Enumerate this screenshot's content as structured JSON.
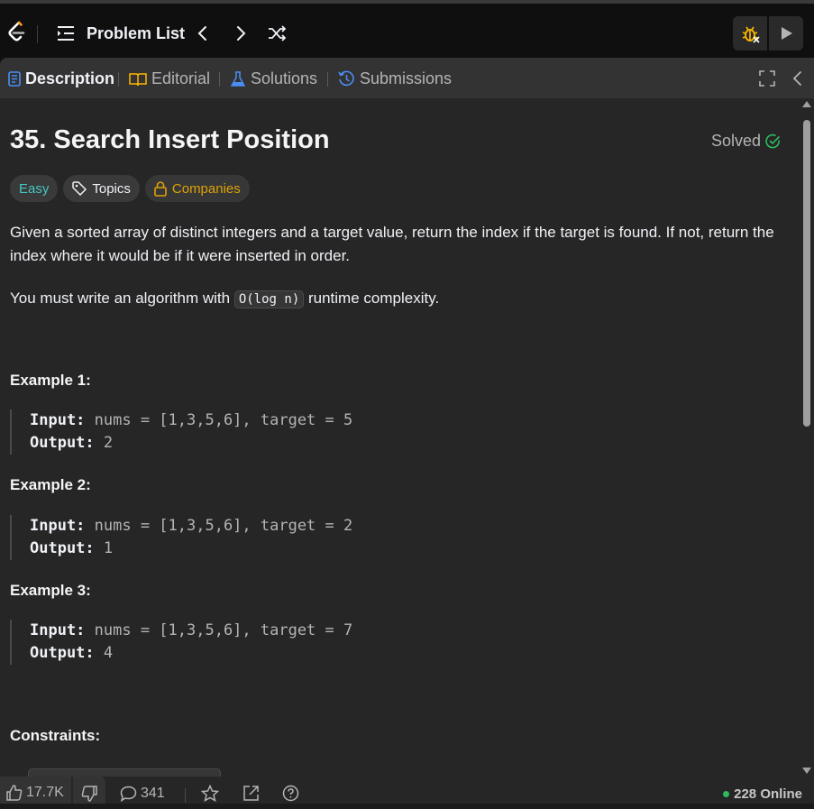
{
  "topbar": {
    "problem_list_label": "Problem List"
  },
  "tabs": [
    {
      "label": "Description",
      "icon": "description-icon",
      "color": "#4a8ef5"
    },
    {
      "label": "Editorial",
      "icon": "book-icon",
      "color": "#ffb800"
    },
    {
      "label": "Solutions",
      "icon": "flask-icon",
      "color": "#4a8ef5"
    },
    {
      "label": "Submissions",
      "icon": "history-icon",
      "color": "#4a8ef5"
    }
  ],
  "problem": {
    "title": "35. Search Insert Position",
    "status": "Solved",
    "difficulty": "Easy",
    "topics_label": "Topics",
    "companies_label": "Companies",
    "desc_p1": "Given a sorted array of distinct integers and a target value, return the index if the target is found. If not, return the index where it would be if it were inserted in order.",
    "desc_p2_before": "You must write an algorithm with ",
    "desc_p2_code": "O(log n)",
    "desc_p2_after": " runtime complexity.",
    "examples": [
      {
        "title": "Example 1:",
        "input_label": "Input:",
        "input": " nums = [1,3,5,6], target = 5",
        "output_label": "Output:",
        "output": " 2"
      },
      {
        "title": "Example 2:",
        "input_label": "Input:",
        "input": " nums = [1,3,5,6], target = 2",
        "output_label": "Output:",
        "output": " 1"
      },
      {
        "title": "Example 3:",
        "input_label": "Input:",
        "input": " nums = [1,3,5,6], target = 7",
        "output_label": "Output:",
        "output": " 4"
      }
    ],
    "constraints_label": "Constraints:"
  },
  "footer": {
    "likes": "17.7K",
    "comments": "341",
    "online": "228 Online"
  },
  "colors": {
    "easy": "#46c6c2",
    "companies": "#ffb800",
    "solved_check": "#2cbb5d",
    "online_dot": "#2cbb5d",
    "logo": "#ffa116"
  }
}
